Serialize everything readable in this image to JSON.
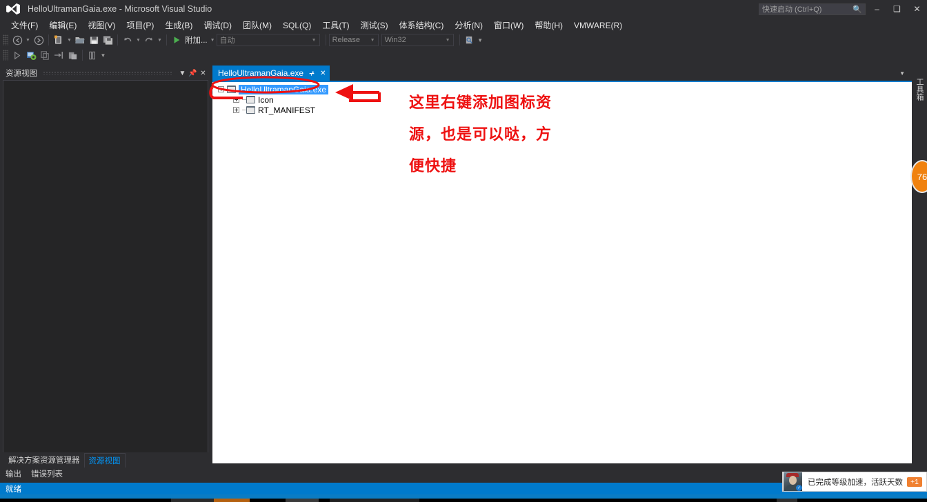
{
  "window": {
    "title": "HelloUltramanGaia.exe - Microsoft Visual Studio",
    "logo_icon": "visual-studio-logo-icon",
    "minimize_icon": "minimize-icon",
    "restore_icon": "restore-icon",
    "close_icon": "close-icon"
  },
  "quick_launch": {
    "placeholder": "快速启动 (Ctrl+Q)",
    "search_icon": "search-icon"
  },
  "menu": {
    "items": [
      {
        "label": "文件(F)"
      },
      {
        "label": "编辑(E)"
      },
      {
        "label": "视图(V)"
      },
      {
        "label": "项目(P)"
      },
      {
        "label": "生成(B)"
      },
      {
        "label": "调试(D)"
      },
      {
        "label": "团队(M)"
      },
      {
        "label": "SQL(Q)"
      },
      {
        "label": "工具(T)"
      },
      {
        "label": "测试(S)"
      },
      {
        "label": "体系结构(C)"
      },
      {
        "label": "分析(N)"
      },
      {
        "label": "窗口(W)"
      },
      {
        "label": "帮助(H)"
      },
      {
        "label": "VMWARE(R)"
      }
    ]
  },
  "toolbar": {
    "attach_label": "附加...",
    "config_combo": "自动",
    "solution_config": "Release",
    "solution_platform": "Win32",
    "icons_row1": [
      "navigate-back-icon",
      "navigate-forward-icon",
      "new-project-icon",
      "open-file-icon",
      "save-icon",
      "save-all-icon",
      "undo-icon",
      "redo-icon",
      "start-debug-icon"
    ],
    "icons_row2": [
      "step-over-icon",
      "debug-target-icon",
      "copy-icon",
      "step-into-icon",
      "paste-icon",
      "columns-icon"
    ]
  },
  "left_panel": {
    "title": "资源视图",
    "dropdown_icon": "chevron-down-icon",
    "pin_icon": "pin-icon",
    "close_icon": "close-icon",
    "tabs": [
      {
        "label": "解决方案资源管理器",
        "active": false
      },
      {
        "label": "资源视图",
        "active": true
      }
    ],
    "output_tabs": [
      {
        "label": "输出"
      },
      {
        "label": "错误列表"
      }
    ]
  },
  "document_tab": {
    "label": "HelloUltramanGaia.exe",
    "pin_icon": "pin-icon",
    "close_icon": "close-icon",
    "overflow_icon": "chevron-down-icon"
  },
  "resource_tree": {
    "nodes": [
      {
        "label": "HelloUltramanGaia.exe",
        "selected": true,
        "level": 0,
        "icon": "resource-folder-icon"
      },
      {
        "label": "Icon",
        "selected": false,
        "level": 1,
        "icon": "resource-folder-icon"
      },
      {
        "label": "RT_MANIFEST",
        "selected": false,
        "level": 1,
        "icon": "resource-folder-icon"
      }
    ]
  },
  "annotation": {
    "lines": [
      "这里右键添加图标资",
      "源，也是可以哒，方",
      "便快捷"
    ],
    "color": "#ee1111",
    "ellipse_name": "red-highlight-ellipse",
    "arrow_name": "red-arrow-pointer"
  },
  "right_rail": {
    "toolbox_label": "工具箱",
    "badge_value": "76",
    "badge_color": "#f0820f"
  },
  "status_bar": {
    "text": "就绪",
    "background": "#007acc"
  },
  "notification": {
    "text": "已完成等级加速，活跃天数",
    "badge": "+1",
    "badge_color": "#f08030",
    "avatar_icon": "user-avatar-icon"
  }
}
